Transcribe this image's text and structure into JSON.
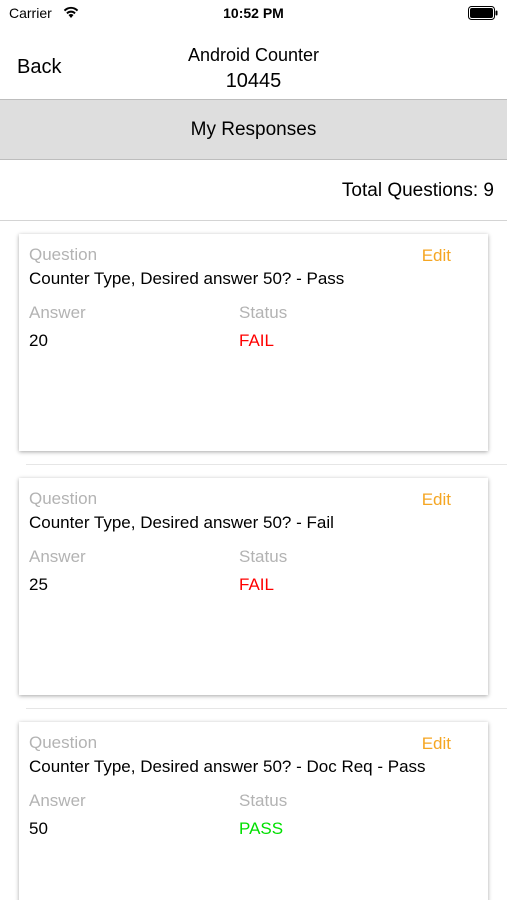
{
  "status_bar": {
    "carrier": "Carrier",
    "time": "10:52 PM"
  },
  "nav": {
    "back_label": "Back",
    "title": "Android Counter",
    "subtitle": "10445"
  },
  "section": {
    "title": "My Responses"
  },
  "total": {
    "text": "Total Questions: 9"
  },
  "colors": {
    "edit": "#f5a623",
    "fail": "#ff0000",
    "pass": "#00e000",
    "label": "#b3b3b3",
    "header_bg": "#dedede"
  },
  "responses": [
    {
      "question_label": "Question",
      "question": "Counter Type, Desired answer 50? - Pass",
      "edit_label": "Edit",
      "answer_label": "Answer",
      "answer": "20",
      "status_label": "Status",
      "status": "FAIL"
    },
    {
      "question_label": "Question",
      "question": "Counter Type, Desired answer 50? - Fail",
      "edit_label": "Edit",
      "answer_label": "Answer",
      "answer": "25",
      "status_label": "Status",
      "status": "FAIL"
    },
    {
      "question_label": "Question",
      "question": "Counter Type, Desired answer 50? - Doc Req - Pass",
      "edit_label": "Edit",
      "answer_label": "Answer",
      "answer": "50",
      "status_label": "Status",
      "status": "PASS"
    }
  ]
}
